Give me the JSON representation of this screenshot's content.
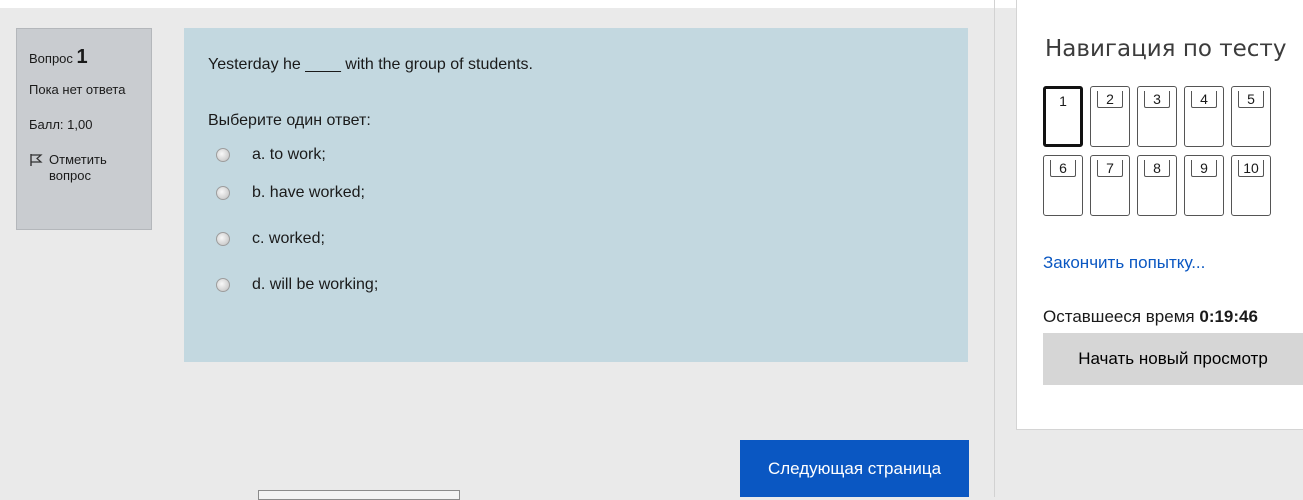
{
  "question_info": {
    "number_prefix": "Вопрос",
    "number": "1",
    "state": "Пока нет ответа",
    "grade": "Балл: 1,00",
    "flag_label": "Отметить вопрос"
  },
  "question": {
    "text": "Yesterday he ____ with the group of students.",
    "prompt": "Выберите один ответ:",
    "answers": [
      {
        "label": "a. to work;"
      },
      {
        "label": "b. have worked;"
      },
      {
        "label": "c. worked;"
      },
      {
        "label": "d. will be working;"
      }
    ]
  },
  "buttons": {
    "next_page": "Следующая страница"
  },
  "navigation": {
    "title": "Навигация по тесту",
    "questions": [
      "1",
      "2",
      "3",
      "4",
      "5",
      "6",
      "7",
      "8",
      "9",
      "10"
    ],
    "current": "1",
    "finish_attempt": "Закончить попытку...",
    "time_left_label": "Оставшееся время",
    "time_left_value": "0:19:46",
    "new_preview": "Начать новый просмотр"
  },
  "colors": {
    "accent": "#0a57c2",
    "question_bg": "#c3d8e0",
    "info_bg": "#c9ccd0"
  }
}
